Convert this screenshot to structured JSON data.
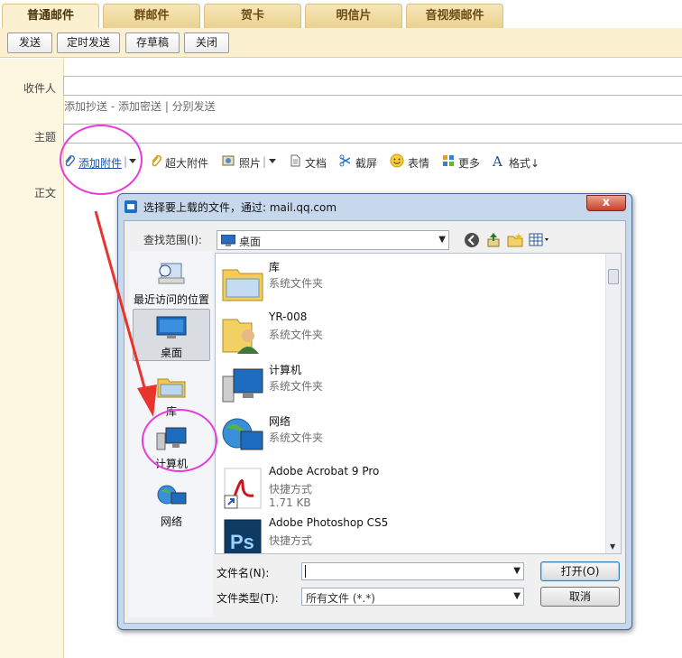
{
  "tabs": [
    "普通邮件",
    "群邮件",
    "贺卡",
    "明信片",
    "音视频邮件"
  ],
  "toolbar": {
    "send": "发送",
    "scheduled": "定时发送",
    "draft": "存草稿",
    "close": "关闭"
  },
  "compose": {
    "recipient_label": "收件人",
    "cc": "添加抄送",
    "dash": " - ",
    "bcc": "添加密送",
    "bar": " | ",
    "separate": "分别发送",
    "subject_label": "主题",
    "body_label": "正文"
  },
  "attach_bar": {
    "add_attachment": "添加附件",
    "large_attachment": "超大附件",
    "photo": "照片",
    "document": "文档",
    "screenshot": "截屏",
    "emoji": "表情",
    "more": "更多",
    "format": "格式↓"
  },
  "dialog": {
    "title": "选择要上载的文件，通过: mail.qq.com",
    "close": "x",
    "look_in_label": "查找范围(I):",
    "look_in_value": "桌面",
    "places": [
      "最近访问的位置",
      "桌面",
      "库",
      "计算机",
      "网络"
    ],
    "files": [
      {
        "name": "库",
        "sub": "系统文件夹"
      },
      {
        "name": "YR-008",
        "sub": "系统文件夹"
      },
      {
        "name": "计算机",
        "sub": "系统文件夹"
      },
      {
        "name": "网络",
        "sub": "系统文件夹"
      },
      {
        "name": "Adobe Acrobat 9 Pro",
        "sub": "快捷方式",
        "size": "1.71 KB"
      },
      {
        "name": "Adobe Photoshop CS5",
        "sub": "快捷方式",
        "size": ""
      }
    ],
    "filename_label": "文件名(N):",
    "filename_value": "",
    "filetype_label": "文件类型(T):",
    "filetype_value": "所有文件 (*.*)",
    "open_button": "打开(O)",
    "cancel_button": "取消"
  },
  "colors": {
    "tab_bg": "#ebd192",
    "toolbar_bg": "#fbf0d0",
    "annotation": "#e73cda",
    "arrow": "#e8332e"
  }
}
